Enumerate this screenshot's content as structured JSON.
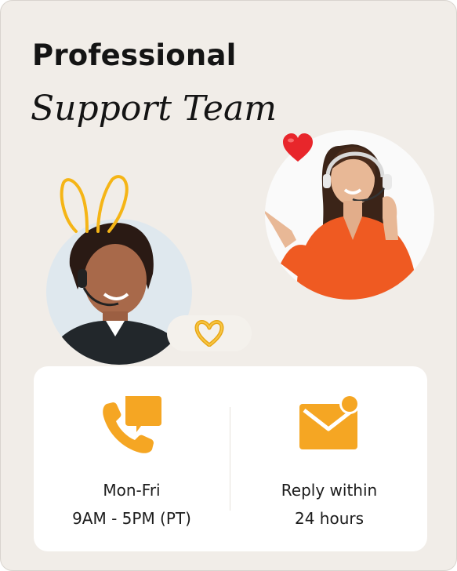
{
  "header": {
    "title_line1": "Professional",
    "title_line2": "Support Team"
  },
  "photos": {
    "left": "agent-with-bunny-ears-photo",
    "right": "agent-pointing-photo"
  },
  "icons": {
    "heart": "heart-icon",
    "heart_hands": "heart-hands-icon",
    "phone": "phone-chat-icon",
    "mail": "envelope-notification-icon"
  },
  "info": {
    "hours": {
      "line1": "Mon-Fri",
      "line2": "9AM - 5PM (PT)"
    },
    "reply": {
      "line1": "Reply within",
      "line2": "24 hours"
    }
  },
  "colors": {
    "background": "#f1ede8",
    "accent": "#f5a623",
    "heart": "#e8262b",
    "panel": "#ffffff",
    "text": "#141414"
  }
}
